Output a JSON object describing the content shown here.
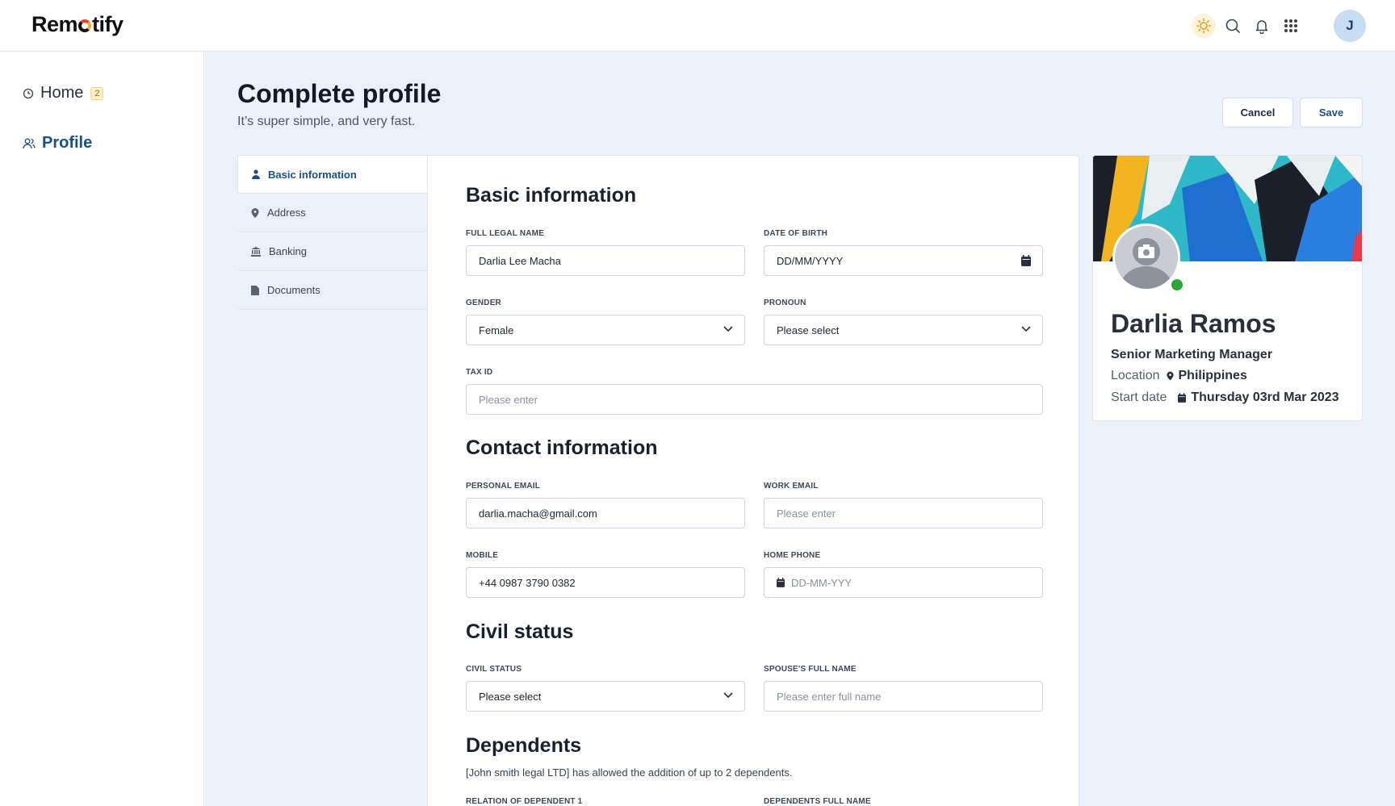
{
  "app": {
    "logo": "Remotify"
  },
  "topbar": {
    "avatar_initial": "J"
  },
  "sidebar": {
    "items": [
      {
        "label": "Home",
        "badge": "2"
      },
      {
        "label": "Profile"
      }
    ]
  },
  "page": {
    "title": "Complete profile",
    "subtitle": "It’s super simple, and very fast.",
    "cancel_label": "Cancel",
    "save_label": "Save"
  },
  "subnav": {
    "items": [
      {
        "label": "Basic information",
        "icon": "person-icon"
      },
      {
        "label": "Address",
        "icon": "pin-icon"
      },
      {
        "label": "Banking",
        "icon": "bank-icon"
      },
      {
        "label": "Documents",
        "icon": "document-icon"
      }
    ]
  },
  "form": {
    "basic": {
      "title": "Basic information",
      "full_name_label": "FULL LEGAL NAME",
      "full_name_value": "Darlia Lee Macha",
      "dob_label": "DATE OF BIRTH",
      "dob_value": "DD/MM/YYYY",
      "gender_label": "GENDER",
      "gender_value": "Female",
      "pronoun_label": "PRONOUN",
      "pronoun_value": "Please select",
      "taxid_label": "TAX ID",
      "taxid_placeholder": "Please enter"
    },
    "contact": {
      "title": "Contact information",
      "personal_email_label": "PERSONAL EMAIL",
      "personal_email_value": "darlia.macha@gmail.com",
      "work_email_label": "WORK EMAIL",
      "work_email_placeholder": "Please enter",
      "mobile_label": "MOBILE",
      "mobile_value": "+44 0987 3790 0382",
      "home_phone_label": "HOME PHONE",
      "home_phone_placeholder": "DD-MM-YYY"
    },
    "civil": {
      "title": "Civil status",
      "status_label": "CIVIL STATUS",
      "status_value": "Please select",
      "spouse_label": "SPOUSE'S FULL NAME",
      "spouse_placeholder": "Please enter full name"
    },
    "dependents": {
      "title": "Dependents",
      "note": "[John smith legal LTD] has allowed the addition of up to 2 dependents.",
      "relation_label": "RELATION OF DEPENDENT 1",
      "fullname_label": "DEPENDENTS FULL NAME"
    }
  },
  "profile_card": {
    "name": "Darlia Ramos",
    "role": "Senior Marketing Manager",
    "location_label": "Location",
    "location_value": "Philippines",
    "start_label": "Start date",
    "start_value": "Thursday 03rd Mar 2023",
    "status_color": "#2aa833"
  },
  "colors": {
    "accent": "#1b4f86",
    "background": "#ebf1fa"
  }
}
